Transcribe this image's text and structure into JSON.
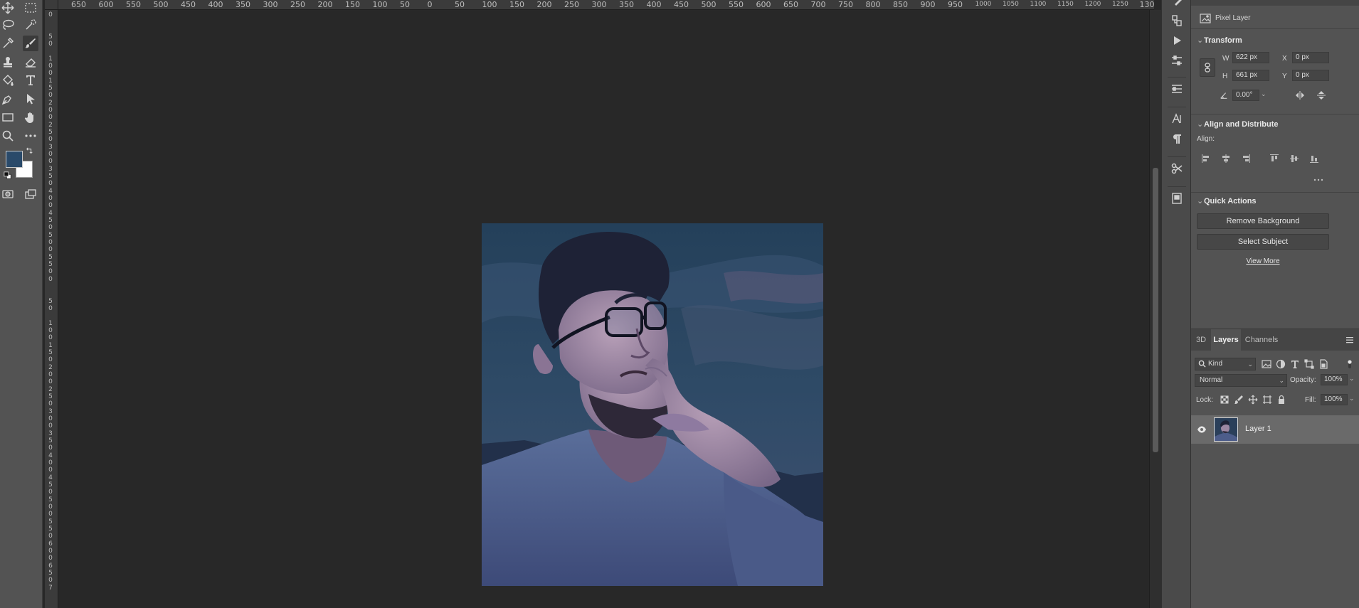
{
  "colors": {
    "foreground": "#2a4a6a",
    "background": "#ffffff",
    "workspace": "#282828",
    "panel": "#535353"
  },
  "tools": [
    {
      "name": "move-tool",
      "icon": "move-icon"
    },
    {
      "name": "marquee-tool",
      "icon": "rect-marquee-icon"
    },
    {
      "name": "lasso-tool",
      "icon": "lasso-icon"
    },
    {
      "name": "quick-selection-tool",
      "icon": "quick-select-icon"
    },
    {
      "name": "eyedropper-tool",
      "icon": "eyedropper-icon"
    },
    {
      "name": "brush-tool",
      "icon": "brush-icon"
    },
    {
      "name": "stamp-tool",
      "icon": "stamp-icon"
    },
    {
      "name": "eraser-tool",
      "icon": "eraser-icon"
    },
    {
      "name": "paint-bucket-tool",
      "icon": "bucket-icon"
    },
    {
      "name": "type-tool",
      "icon": "type-icon"
    },
    {
      "name": "pen-tool",
      "icon": "pen-icon"
    },
    {
      "name": "path-selection-tool",
      "icon": "arrow-icon"
    },
    {
      "name": "rectangle-tool",
      "icon": "rectangle-icon"
    },
    {
      "name": "hand-tool",
      "icon": "hand-icon"
    },
    {
      "name": "zoom-tool",
      "icon": "zoom-icon"
    },
    {
      "name": "more-tools",
      "icon": "ellipsis-icon"
    }
  ],
  "ruler_top": [
    "650",
    "600",
    "550",
    "500",
    "450",
    "400",
    "350",
    "300",
    "250",
    "200",
    "150",
    "100",
    "50",
    "0",
    "50",
    "100",
    "150",
    "200",
    "250",
    "300",
    "350",
    "400",
    "450",
    "500",
    "550",
    "600",
    "650",
    "700",
    "750",
    "800",
    "850",
    "900",
    "950",
    "1000",
    "1050",
    "1100",
    "1150",
    "1200",
    "1250",
    "130"
  ],
  "ruler_left": [
    "0",
    "5\n0",
    "1\n0\n0",
    "1\n5\n0",
    "2\n0\n0",
    "2\n5\n0",
    "3\n0\n0",
    "3\n5\n0",
    "4\n0\n0",
    "4\n5\n0",
    "5\n0\n0",
    "5\n5\n0",
    "0",
    "5\n0",
    "1\n0\n0",
    "1\n5\n0",
    "2\n0\n0",
    "2\n5\n0",
    "3\n0\n0",
    "3\n5\n0",
    "4\n0\n0",
    "4\n5\n0",
    "5\n0\n0",
    "5\n5\n0",
    "6\n0\n0",
    "6\n5\n0",
    "7"
  ],
  "properties": {
    "layer_type": "Pixel Layer",
    "transform": {
      "title": "Transform",
      "w_label": "W",
      "w_value": "622 px",
      "h_label": "H",
      "h_value": "661 px",
      "x_label": "X",
      "x_value": "0 px",
      "y_label": "Y",
      "y_value": "0 px",
      "angle_value": "0.00°"
    },
    "align": {
      "title": "Align and Distribute",
      "align_label": "Align:"
    },
    "quick_actions": {
      "title": "Quick Actions",
      "remove_background": "Remove Background",
      "select_subject": "Select Subject",
      "view_more": "View More"
    }
  },
  "layers_panel": {
    "tabs": [
      "3D",
      "Layers",
      "Channels"
    ],
    "active_tab": "Layers",
    "filter_kind": "Kind",
    "blend_mode": "Normal",
    "opacity_label": "Opacity:",
    "opacity_value": "100%",
    "lock_label": "Lock:",
    "fill_label": "Fill:",
    "fill_value": "100%",
    "layers": [
      {
        "name": "Layer 1",
        "visible": true,
        "selected": true
      }
    ]
  }
}
